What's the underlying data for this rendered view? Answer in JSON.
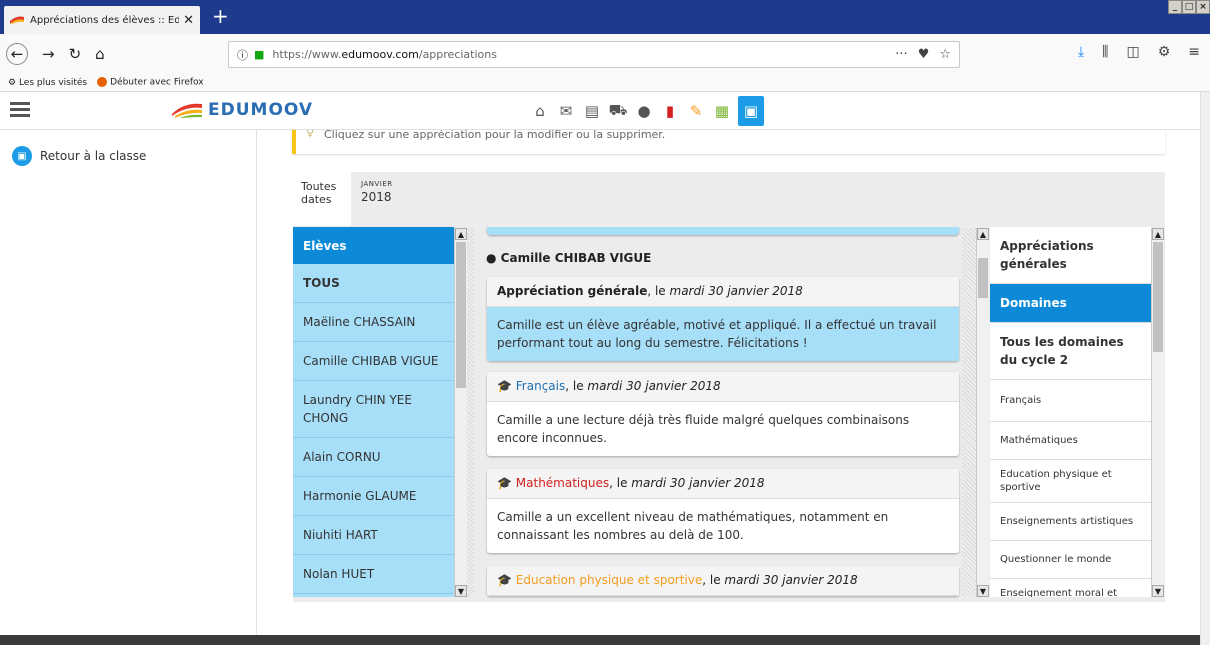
{
  "browser": {
    "tab_title": "Appréciations des élèves :: Edumo",
    "url_prefix": "https://www.",
    "url_domain": "edumoov.com",
    "url_path": "/appreciations",
    "bookmarks": [
      "Les plus visités",
      "Débuter avec Firefox"
    ],
    "win_controls": [
      "_",
      "□",
      "×"
    ]
  },
  "app": {
    "logo_text": "EDUMOOV",
    "sidebar_back": "Retour à la classe",
    "hint_text": "Cliquez sur une appréciation pour la modifier ou la supprimer.",
    "nav_icons": [
      "home-icon",
      "mail-icon",
      "book-icon",
      "cart-icon",
      "user-icon",
      "document-icon",
      "pencil-icon",
      "calendar-icon",
      "briefcase-icon"
    ]
  },
  "date_tabs": [
    {
      "line1": "Toutes",
      "line2": "dates"
    },
    {
      "small": "Janvier",
      "year": "2018"
    }
  ],
  "students": {
    "header": "Elèves",
    "items": [
      "TOUS",
      "Maëline CHASSAIN",
      "Camille CHIBAB VIGUE",
      "Laundry CHIN YEE CHONG",
      "Alain CORNU",
      "Harmonie GLAUME",
      "Niuhiti HART",
      "Nolan HUET"
    ]
  },
  "appreciations": {
    "student": "Camille CHIBAB VIGUE",
    "cards": [
      {
        "subject": "Appréciation générale",
        "connector": ", le ",
        "date": "mardi 30 janvier 2018",
        "text": "Camille est un élève agréable, motivé et appliqué. Il a effectué un travail performant tout au long du semestre. Félicitations !"
      },
      {
        "subject": "Français",
        "connector": ", le ",
        "date": "mardi 30 janvier 2018",
        "text": "Camille a une lecture déjà très fluide malgré quelques combinaisons encore inconnues."
      },
      {
        "subject": "Mathématiques",
        "connector": ", le ",
        "date": "mardi 30 janvier 2018",
        "text": "Camille a un excellent niveau de mathématiques, notamment en connaissant les nombres au delà de 100."
      },
      {
        "subject": "Education physique et sportive",
        "connector": ", le ",
        "date": "mardi 30 janvier 2018",
        "text": ""
      }
    ]
  },
  "domains": {
    "items": [
      "Appréciations générales",
      "Domaines",
      "Tous les domaines du cycle 2",
      "Français",
      "Mathématiques",
      "Education physique et sportive",
      "Enseignements artistiques",
      "Questionner le monde",
      "Enseignement moral et civique"
    ]
  },
  "colors": {
    "brand_blue": "#0c8ad8",
    "light_blue": "#a8dff8",
    "french": "#1f6fb5",
    "math": "#d32020",
    "eps": "#f29c1f"
  }
}
